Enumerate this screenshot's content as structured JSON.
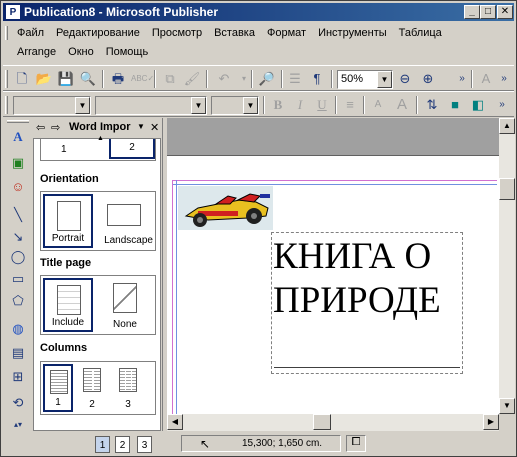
{
  "window": {
    "title": "Publication8 - Microsoft Publisher",
    "app_icon": "publisher-icon",
    "minimize": "_",
    "maximize": "□",
    "close": "✕"
  },
  "menu": {
    "row1": [
      "Файл",
      "Редактирование",
      "Просмотр",
      "Вставка",
      "Формат",
      "Инструменты",
      "Таблица"
    ],
    "row2": [
      "Arrange",
      "Окно",
      "Помощь"
    ]
  },
  "standard_toolbar": {
    "zoom": "50%",
    "icons": [
      "new-icon",
      "open-icon",
      "save-icon",
      "search-file-icon",
      "print-icon",
      "spelling-icon",
      "copy-icon",
      "format-painter-icon",
      "undo-icon",
      "print-preview-icon",
      "columns-icon",
      "paragraph-mark-icon",
      "zoom-out-icon",
      "zoom-in-icon"
    ]
  },
  "formatting_toolbar": {
    "font_style": "",
    "font_name": "",
    "font_size": "",
    "bold": "B",
    "italic": "I",
    "underline": "U"
  },
  "task_pane": {
    "title": "Word Impor",
    "top_pages": [
      "1",
      "2"
    ],
    "sections": {
      "orientation": {
        "title": "Orientation",
        "options": [
          "Portrait",
          "Landscape"
        ],
        "selected": "Portrait"
      },
      "title_page": {
        "title": "Title page",
        "options": [
          "Include",
          "None"
        ],
        "selected": "Include"
      },
      "columns": {
        "title": "Columns",
        "options": [
          "1",
          "2",
          "3"
        ],
        "selected": "1"
      }
    }
  },
  "document": {
    "heading_line1": "КНИГА О",
    "heading_line2": "ПРИРОДЕ",
    "clipart": "race-car-clipart"
  },
  "status": {
    "pages": [
      "1",
      "2",
      "3"
    ],
    "active_page": "1",
    "coordinates": "15,300; 1,650 cm."
  }
}
